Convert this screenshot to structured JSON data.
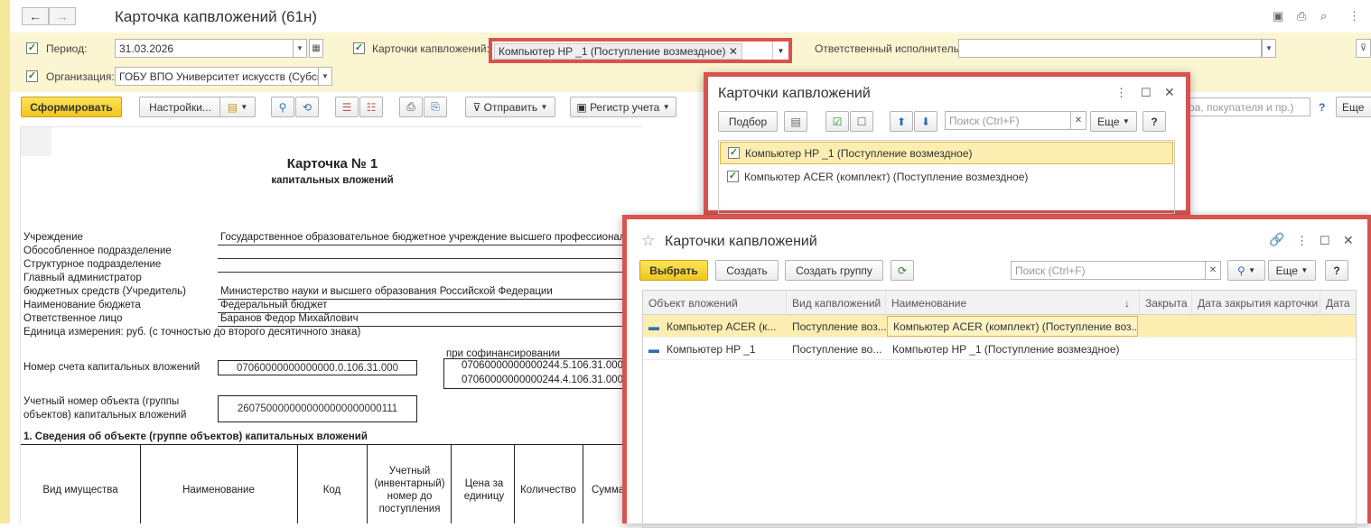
{
  "header": {
    "back_icon": "back-arrow-icon",
    "forward_icon": "forward-arrow-icon",
    "title": "Карточка капвложений (61н)"
  },
  "filters": {
    "period_label": "Период:",
    "period_value": "31.03.2026",
    "cards_label": "Карточки капвложений:",
    "cards_tag": "Компьютер HP _1 (Поступление возмездное)",
    "responsible_label": "Ответственный исполнитель:",
    "responsible_value": "",
    "org_label": "Организация:",
    "org_value": "ГОБУ ВПО Университет искусств (Субси"
  },
  "toolbar": {
    "generate": "Сформировать",
    "settings": "Настройки...",
    "send": "Отправить",
    "register": "Регистр учета",
    "search_partial": "ра, покупателя и пр.)",
    "help": "?",
    "more": "Еще"
  },
  "report": {
    "card_title": "Карточка № 1",
    "card_subtitle": "капитальных вложений",
    "labels": [
      "Учреждение",
      "Обособленное подразделение",
      "Структурное подразделение",
      "Главный администратор",
      "бюджетных средств (Учредитель)",
      "Наименование бюджета",
      "Ответственное лицо",
      "Единица измерения: руб. (с точностью до второго десятичного знака)"
    ],
    "institution": "Государственное образовательное бюджетное учреждение высшего профессионал",
    "founder": "Министерство науки и высшего образования Российской Федерации",
    "budget": "Федеральный бюджет",
    "person": "Баранов Федор Михайлович",
    "cofinancing_label": "при софинансировании",
    "account_label": "Номер счета капитальных вложений",
    "account_value": "07060000000000000.0.106.31.000",
    "cofin_value_1": "07060000000000244.5.106.31.000",
    "cofin_value_2": "07060000000000244.4.106.31.000",
    "object_label_1": "Учетный номер объекта (группы",
    "object_label_2": "объектов) капитальных вложений",
    "object_value": "2607500000000000000000000111",
    "section_title": "1. Сведения об объекте (группе объектов) капитальных вложений",
    "table_headers": [
      "Вид имущества",
      "Наименование",
      "Код",
      "Учетный (инвентарный) номер до поступления",
      "Цена за единицу",
      "Количество",
      "Сумма"
    ]
  },
  "popup1": {
    "title": "Карточки капвложений",
    "select_btn": "Подбор",
    "search_placeholder": "Поиск (Ctrl+F)",
    "more": "Еще",
    "help": "?",
    "items": [
      {
        "label": "Компьютер HP _1 (Поступление возмездное)",
        "checked": true
      },
      {
        "label": "Компьютер ACER (комплект) (Поступление возмездное)",
        "checked": true
      }
    ]
  },
  "popup2": {
    "title": "Карточки капвложений",
    "choose": "Выбрать",
    "create": "Создать",
    "create_group": "Создать группу",
    "search_placeholder": "Поиск (Ctrl+F)",
    "more": "Еще",
    "help": "?",
    "columns": [
      "Объект вложений",
      "Вид капвложений",
      "Наименование",
      "Закрыта",
      "Дата закрытия карточки",
      "Дата"
    ],
    "sort_indicator": "↓",
    "rows": [
      {
        "object": "Компьютер ACER (к...",
        "kind": "Поступление воз...",
        "name": "Компьютер ACER (комплект) (Поступление воз...",
        "closed": "",
        "close_date": "",
        "date": ""
      },
      {
        "object": "Компьютер HP _1",
        "kind": "Поступление во...",
        "name": "Компьютер HP _1 (Поступление возмездное)",
        "closed": "",
        "close_date": "",
        "date": ""
      }
    ]
  },
  "colors": {
    "accent_yellow": "#f2c61c",
    "highlight_border": "#d9534f",
    "filter_bg": "#fcf5d2",
    "selected_row": "#fbeeb0"
  }
}
